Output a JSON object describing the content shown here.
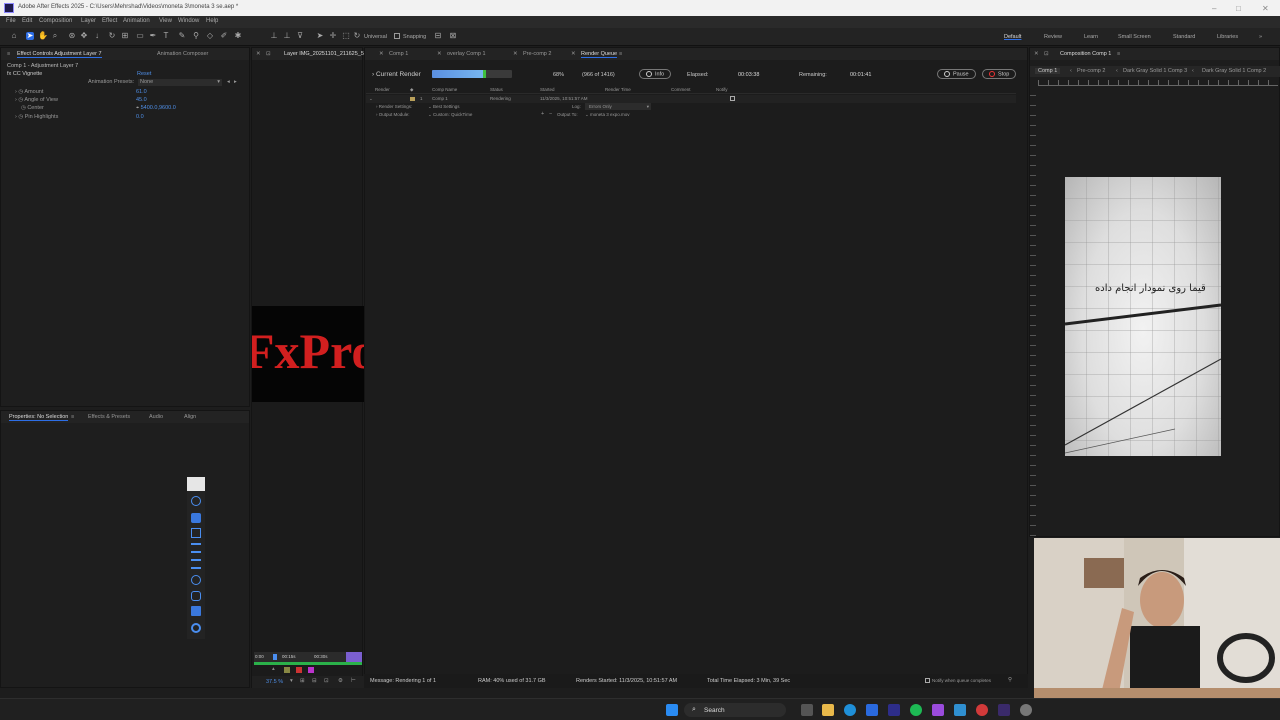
{
  "window": {
    "title": "Adobe After Effects 2025 - C:\\Users\\Mehrshad\\Videos\\moneta 3\\moneta 3 se.aep *"
  },
  "menu": [
    "File",
    "Edit",
    "Composition",
    "Layer",
    "Effect",
    "Animation",
    "View",
    "Window",
    "Help"
  ],
  "toolbar": {
    "universal": "Universal",
    "snapping": "Snapping",
    "workspaces": [
      "Default",
      "Review",
      "Learn",
      "Small Screen",
      "Standard",
      "Libraries"
    ]
  },
  "effect_controls": {
    "tabs": [
      "Effect Controls Adjustment Layer 7",
      "Animation Composer"
    ],
    "layer": "Comp 1 - Adjustment Layer 7",
    "effect": "CC Vignette",
    "reset": "Reset",
    "presets_label": "Animation Presets:",
    "presets_value": "None",
    "params": [
      {
        "name": "Amount",
        "value": "61.0"
      },
      {
        "name": "Angle of View",
        "value": "45.0"
      },
      {
        "name": "Center",
        "value": "5400.0,9600.0"
      },
      {
        "name": "Pin Highlights",
        "value": "0.0"
      }
    ]
  },
  "properties": {
    "tabs": [
      "Properties: No Selection",
      "Effects & Presets",
      "Audio",
      "Align"
    ]
  },
  "layer_viewer": {
    "tab": "Layer IMG_20251101_211625_5",
    "logo_text": "FxPro",
    "zoom": "37.5 %",
    "time_in": "0:00",
    "time_a": "00:15s",
    "time_b": "00:30s",
    "time_end": "0:05"
  },
  "render_queue": {
    "tabs": [
      "Comp 1",
      "overlay Comp 1",
      "Pre-comp 2",
      "Render Queue"
    ],
    "current_render": "Current Render",
    "percent": "68%",
    "progress": 0.68,
    "frames": "(966 of 1416)",
    "info": "Info",
    "elapsed_label": "Elapsed:",
    "elapsed": "00:03:38",
    "remaining_label": "Remaining:",
    "remaining": "00:01:41",
    "pause": "Pause",
    "stop": "Stop",
    "columns": [
      "Render",
      "Comp Name",
      "Status",
      "Started",
      "Render Time",
      "Comment",
      "Notify"
    ],
    "item": {
      "index": "1",
      "comp": "Comp 1",
      "status": "Rendering",
      "started": "11/3/2025, 10:51:57 AM"
    },
    "render_settings_label": "Render Settings:",
    "render_settings_value": "Best Settings",
    "log_label": "Log:",
    "log_value": "Errors Only",
    "output_module_label": "Output Module:",
    "output_module_value": "Custom: QuickTime",
    "output_to_label": "Output To:",
    "output_to_value": "moneta 3 expo.mov",
    "status_bar": {
      "message": "Message: Rendering 1 of 1",
      "ram": "RAM: 40% used of 31.7 GB",
      "renders_started": "Renders Started: 11/3/2025, 10:51:57 AM",
      "total_time": "Total Time Elapsed: 3 Min, 39 Sec",
      "notify": "Notify when queue completes"
    }
  },
  "composition": {
    "tab": "Composition Comp 1",
    "breadcrumbs": [
      "Comp 1",
      "Pre-comp 2",
      "Dark Gray Solid 1 Comp 3",
      "Dark Gray Solid 1 Comp 2"
    ],
    "caption": "قیما روی نمودار انجام داده"
  },
  "taskbar": {
    "search": "Search"
  },
  "colors": {
    "accent": "#2d6ee6",
    "progress_done": "#3fbf3f",
    "logo_red": "#d21f1f"
  }
}
